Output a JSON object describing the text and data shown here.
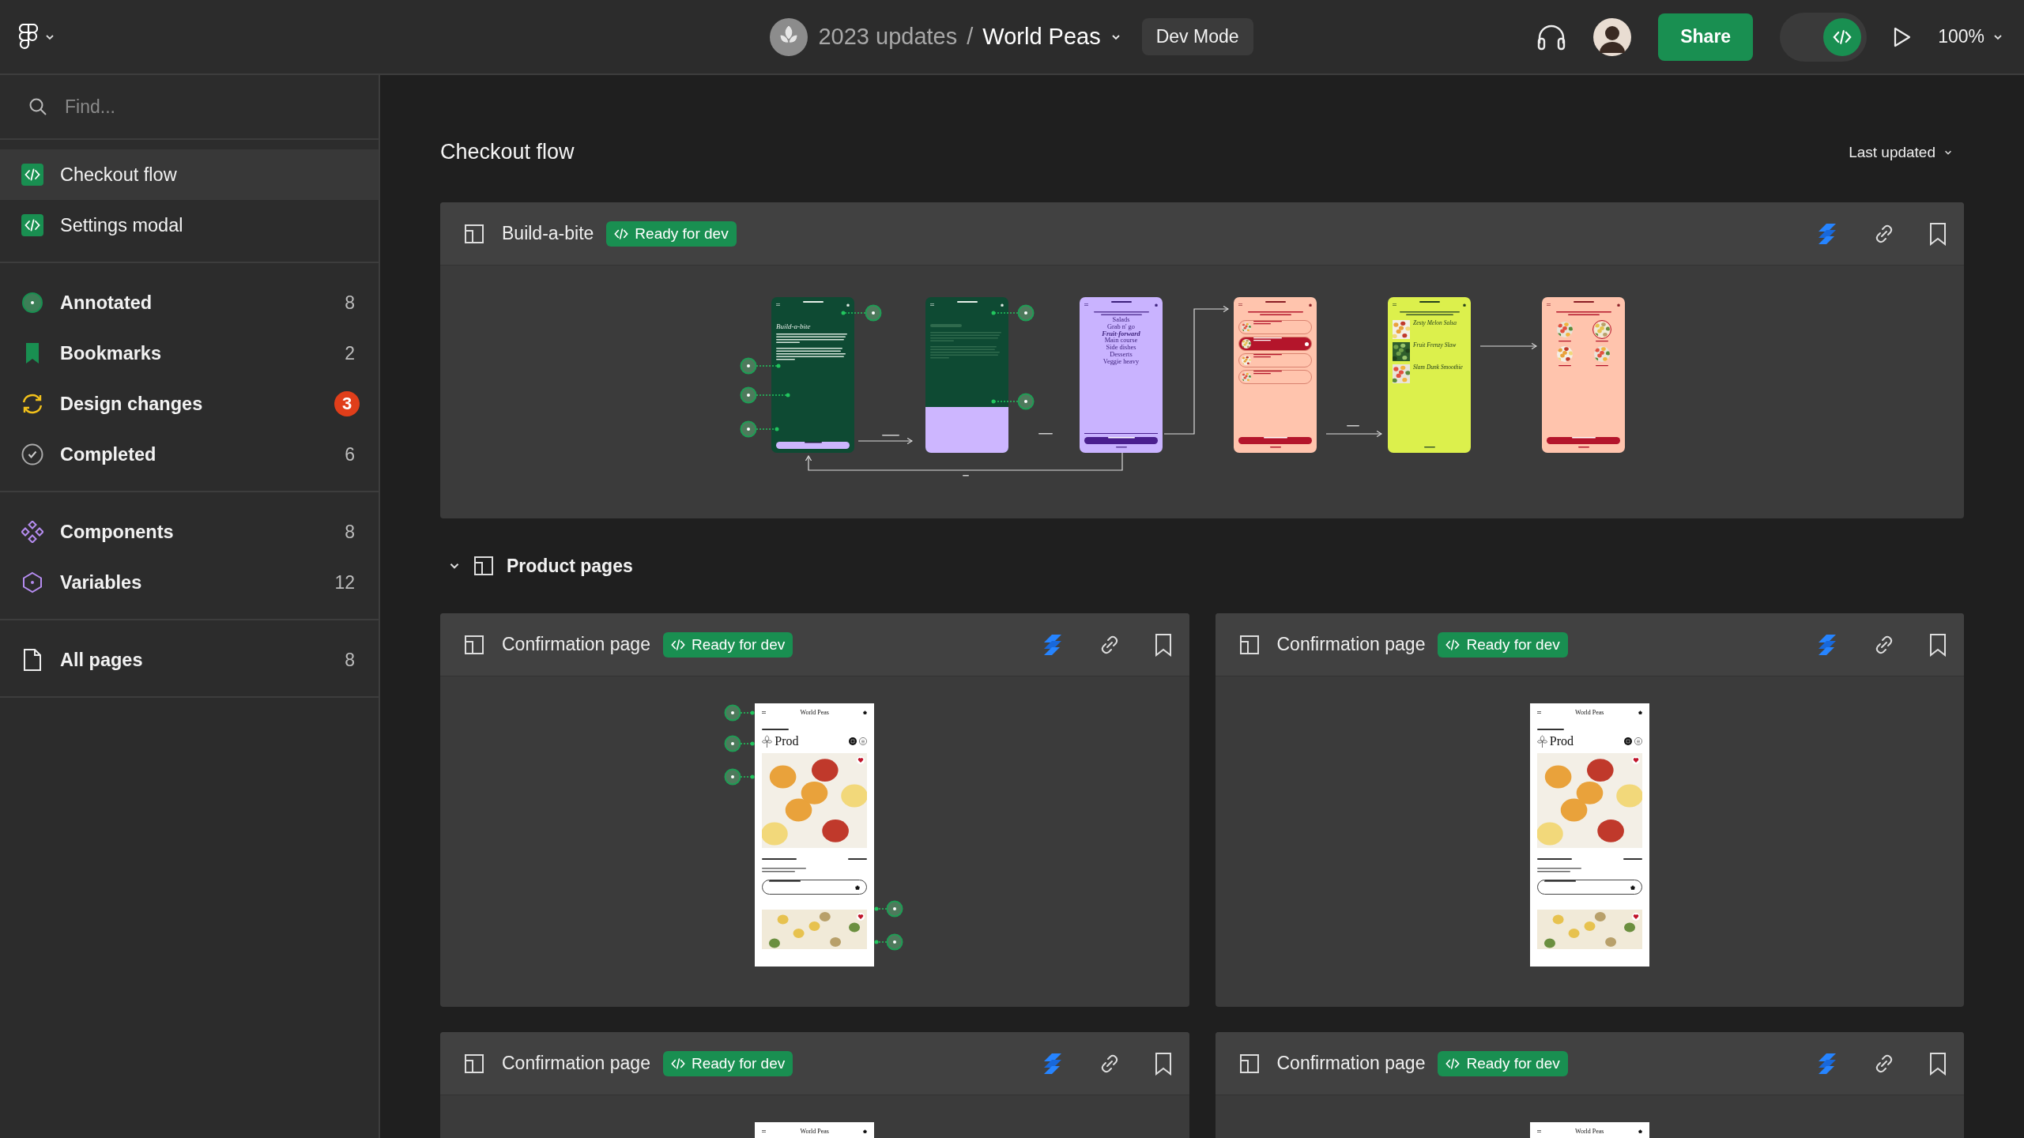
{
  "topbar": {
    "project": "2023 updates",
    "separator": "/",
    "file": "World Peas",
    "mode_badge": "Dev Mode",
    "share": "Share",
    "dev_mode": true,
    "zoom": "100%"
  },
  "sidebar": {
    "search": {
      "placeholder": "Find..."
    },
    "sections": [
      {
        "kind": "pages",
        "items": [
          {
            "label": "Checkout flow",
            "selected": true
          },
          {
            "label": "Settings modal",
            "selected": false
          }
        ]
      },
      {
        "kind": "filters",
        "items": [
          {
            "kind": "annotated",
            "label": "Annotated",
            "count": "8",
            "alert": false,
            "selected": false
          },
          {
            "kind": "bookmarks",
            "label": "Bookmarks",
            "count": "2",
            "alert": false,
            "selected": false
          },
          {
            "kind": "changes",
            "label": "Design changes",
            "count": "3",
            "alert": true,
            "selected": false
          },
          {
            "kind": "completed",
            "label": "Completed",
            "count": "6",
            "alert": false,
            "selected": false
          }
        ]
      },
      {
        "kind": "library",
        "items": [
          {
            "kind": "components",
            "label": "Components",
            "count": "8",
            "alert": false,
            "selected": false
          },
          {
            "kind": "variables",
            "label": "Variables",
            "count": "12",
            "alert": false,
            "selected": false
          }
        ]
      },
      {
        "kind": "all",
        "items": [
          {
            "kind": "file",
            "label": "All pages",
            "count": "8",
            "alert": false,
            "selected": false
          }
        ]
      }
    ]
  },
  "main": {
    "title": "Checkout flow",
    "sort": "Last updated"
  },
  "flow_card": {
    "name": "Build-a-bite",
    "status": "Ready for dev",
    "screens": [
      {
        "kind": "intro",
        "heading": "Build-a-bite"
      },
      {
        "kind": "intro_faded"
      },
      {
        "kind": "category",
        "options": [
          {
            "label": "Salads",
            "selected": false
          },
          {
            "label": "Grab n' go",
            "selected": false
          },
          {
            "label": "Fruit-forward",
            "selected": true
          },
          {
            "label": "Main course",
            "selected": false
          },
          {
            "label": "Side dishes",
            "selected": false
          },
          {
            "label": "Desserts",
            "selected": false
          },
          {
            "label": "Veggie heavy",
            "selected": false
          }
        ]
      },
      {
        "kind": "ingredients",
        "items": [
          {
            "selected": false
          },
          {
            "selected": true
          },
          {
            "selected": false
          },
          {
            "selected": false
          }
        ]
      },
      {
        "kind": "recipes",
        "recipes": [
          "Zesty Melon Salsa",
          "Fruit Frenzy Slaw",
          "Slam Dunk Smoothie"
        ]
      },
      {
        "kind": "grid",
        "items": [
          {
            "selected": false
          },
          {
            "selected": true
          },
          {
            "selected": false
          },
          {
            "selected": false
          }
        ]
      }
    ]
  },
  "section": {
    "title": "Product pages",
    "expanded": true
  },
  "cards": [
    {
      "name": "Confirmation page",
      "status": "Ready for dev",
      "annotations": true,
      "screen": {
        "title": "World Peas",
        "heading": "Prod"
      }
    },
    {
      "name": "Confirmation page",
      "status": "Ready for dev",
      "annotations": false,
      "screen": {
        "title": "World Peas",
        "heading": "Prod"
      }
    },
    {
      "name": "Confirmation page",
      "status": "Ready for dev",
      "annotations": false,
      "screen": {
        "title": "World Peas"
      }
    },
    {
      "name": "Confirmation page",
      "status": "Ready for dev",
      "annotations": false,
      "screen": {
        "title": "World Peas"
      }
    }
  ]
}
